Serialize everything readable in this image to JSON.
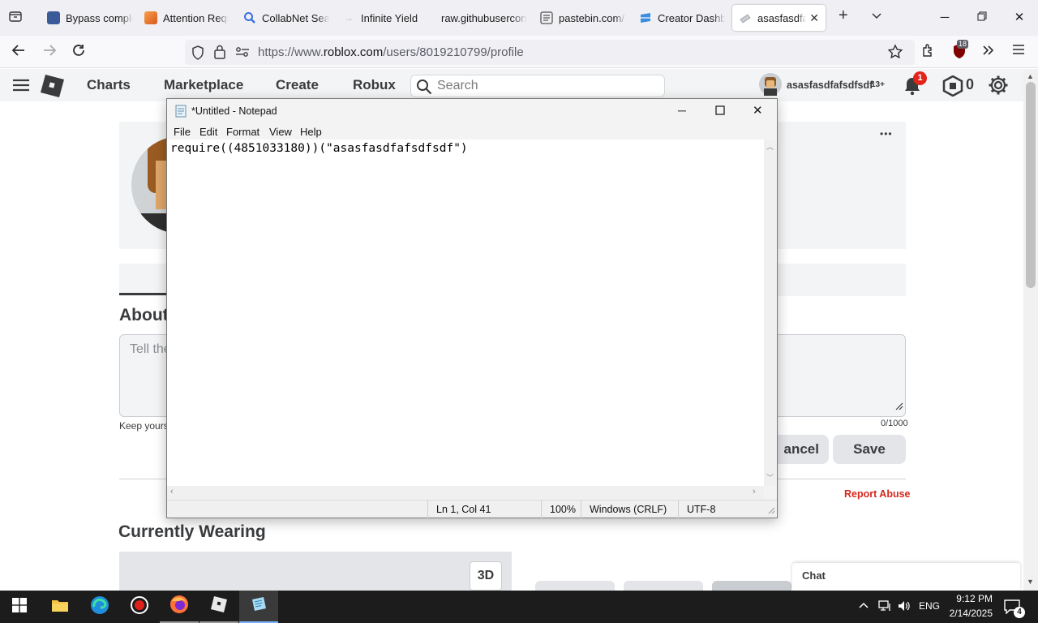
{
  "browser": {
    "tabs": [
      {
        "label": "Bypass complete",
        "icon": "document-icon",
        "color": "#3b5a99"
      },
      {
        "label": "Attention Required",
        "icon": "cloud-icon",
        "color": "#e87a2c"
      },
      {
        "label": "CollabNet Search",
        "icon": "magnifier-icon",
        "color": "#3a6fe0"
      },
      {
        "label": "Infinite Yield",
        "icon": "arrow-icon",
        "color": "#bbbbbb"
      },
      {
        "label": "raw.githubusercontent",
        "icon": "none",
        "color": "#f0f0f4"
      },
      {
        "label": "pastebin.com/",
        "icon": "grid-icon",
        "color": "#555555"
      },
      {
        "label": "Creator Dashboard",
        "icon": "creator-icon",
        "color": "#3a8de0"
      },
      {
        "label": "asasfasdfafsdfsdf",
        "icon": "roblox-tab-icon",
        "color": "#9aa0a6"
      }
    ],
    "url_prefix": "https://www.",
    "url_domain": "roblox.com",
    "url_path": "/users/8019210799/profile",
    "extension_badge": "18"
  },
  "roblox": {
    "nav": [
      "Charts",
      "Marketplace",
      "Create",
      "Robux"
    ],
    "search_placeholder": "Search",
    "username": "asasfasdfafsdfsdf",
    "age_badge": "13+",
    "notification_count": "1",
    "robux_count": "0",
    "about_heading": "About",
    "about_placeholder": "Tell the",
    "keep_yours": "Keep yours",
    "char_count": "0/1000",
    "cancel_label": "ancel",
    "save_label": "Save",
    "report_abuse": "Report Abuse",
    "currently_wearing": "Currently Wearing",
    "view_3d": "3D",
    "chat_label": "Chat",
    "more_dots": "•••",
    "colors": {
      "report": "#d4281e",
      "header_bg": "#f2f4f5"
    }
  },
  "notepad": {
    "title": "*Untitled - Notepad",
    "menu": [
      "File",
      "Edit",
      "Format",
      "View",
      "Help"
    ],
    "content": "require((4851033180))(\"asasfasdfafsdfsdf\")",
    "status": {
      "position": "Ln 1, Col 41",
      "zoom": "100%",
      "line_ending": "Windows (CRLF)",
      "encoding": "UTF-8"
    }
  },
  "taskbar": {
    "language": "ENG",
    "time": "9:12 PM",
    "date": "2/14/2025",
    "notification_count": "4"
  }
}
